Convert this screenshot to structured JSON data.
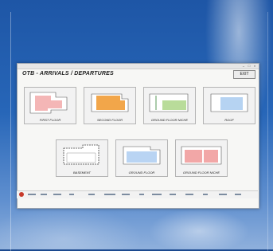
{
  "window": {
    "app_title": "",
    "page_title": "OTB - ARRIVALS / DEPARTURES",
    "exit_label": "EXIT"
  },
  "cards": [
    {
      "label": "FIRST FLOOR",
      "color": "#f4b6b6"
    },
    {
      "label": "SECOND FLOOR",
      "color": "#f2a64a"
    },
    {
      "label": "GROUND FLOOR NICHE",
      "color": "#b9dc9a"
    },
    {
      "label": "ROOF",
      "color": "#b6d3f2"
    },
    {
      "label": "BASEMENT",
      "color": "#ffffff"
    },
    {
      "label": "GROUND FLOOR",
      "color": "#b9d4f3"
    },
    {
      "label": "GROUND FLOOR NICHE",
      "color": "#f2a7a7"
    }
  ],
  "taskbar": {
    "start_icon": "start-orb-icon"
  }
}
